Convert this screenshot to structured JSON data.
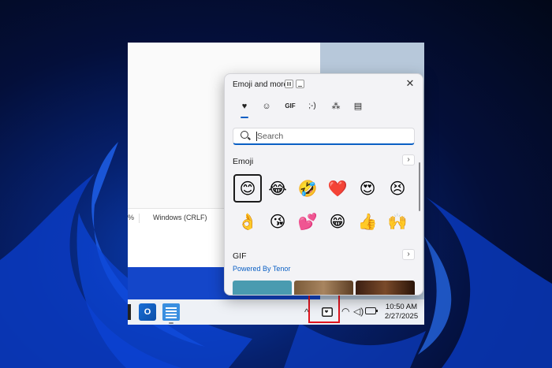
{
  "notepad": {
    "zoom_partial": "%",
    "line_ending": "Windows (CRLF)"
  },
  "emoji_panel": {
    "title": "Emoji and more",
    "close_glyph": "✕",
    "tabs": [
      {
        "label": "emoji-heart-tab",
        "icon": "♥"
      },
      {
        "label": "kaomoji-smiley-tab",
        "icon": "☺"
      },
      {
        "label": "gif-tab",
        "icon": "GIF"
      },
      {
        "label": "kaomoji-tab",
        "icon": ";-)"
      },
      {
        "label": "symbols-tab",
        "icon": "⁂"
      },
      {
        "label": "clipboard-tab",
        "icon": "▤"
      }
    ],
    "search": {
      "placeholder": "Search",
      "value": ""
    },
    "emoji_section": {
      "title": "Emoji",
      "more_glyph": "›"
    },
    "emojis": [
      "😊",
      "😂",
      "🤣",
      "❤️",
      "😍",
      "😣",
      "👌",
      "😘",
      "💕",
      "😁",
      "👍",
      "🙌"
    ],
    "gif_section": {
      "title": "GIF",
      "more_glyph": "›",
      "powered_by": "Powered By Tenor"
    }
  },
  "taskbar": {
    "outlook_letter": "O",
    "chevron": "^",
    "wifi": "◠",
    "volume": "◁)",
    "time": "10:50 AM",
    "date": "2/27/2025"
  },
  "colors": {
    "accent": "#0a5fc4",
    "highlight": "#e0141e",
    "wallpaper": "#06216e"
  }
}
